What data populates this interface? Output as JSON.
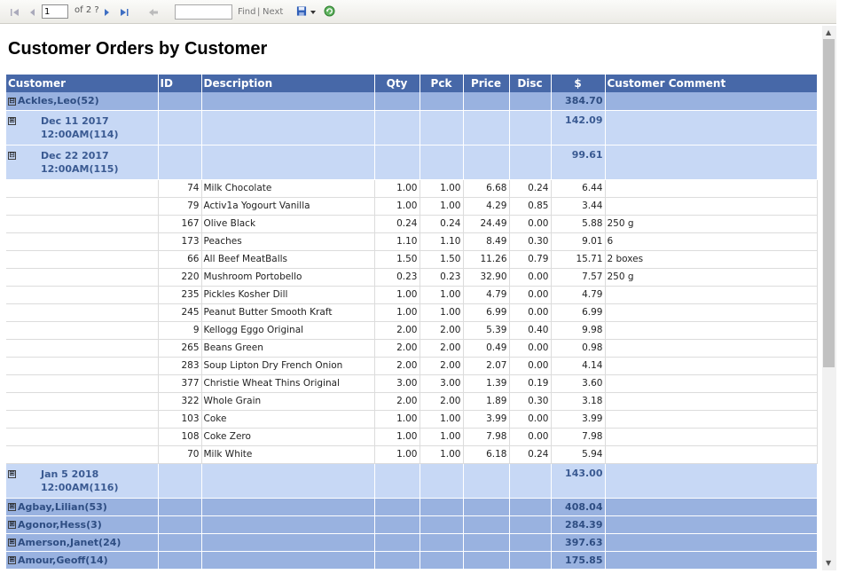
{
  "toolbar": {
    "page_value": "1",
    "page_of": "of 2 ?",
    "find_label": "Find",
    "separator": "|",
    "next_label": "Next"
  },
  "report": {
    "title": "Customer Orders by Customer",
    "columns": [
      "Customer",
      "ID",
      "Description",
      "Qty",
      "Pck",
      "Price",
      "Disc",
      "$",
      "Customer Comment"
    ],
    "customer_main": {
      "toggle": "⊟",
      "name": "Ackles,Leo(52)",
      "total": "384.70"
    },
    "dates": [
      {
        "toggle": "⊞",
        "line1": "Dec 11 2017",
        "line2": "12:00AM(114)",
        "total": "142.09"
      },
      {
        "toggle": "⊟",
        "line1": "Dec 22 2017",
        "line2": "12:00AM(115)",
        "total": "99.61"
      }
    ],
    "items": [
      {
        "id": "74",
        "desc": "Milk Chocolate",
        "qty": "1.00",
        "pck": "1.00",
        "price": "6.68",
        "disc": "0.24",
        "amt": "6.44",
        "comment": ""
      },
      {
        "id": "79",
        "desc": "Activ1a Yogourt Vanilla",
        "qty": "1.00",
        "pck": "1.00",
        "price": "4.29",
        "disc": "0.85",
        "amt": "3.44",
        "comment": ""
      },
      {
        "id": "167",
        "desc": "Olive Black",
        "qty": "0.24",
        "pck": "0.24",
        "price": "24.49",
        "disc": "0.00",
        "amt": "5.88",
        "comment": "250 g"
      },
      {
        "id": "173",
        "desc": "Peaches",
        "qty": "1.10",
        "pck": "1.10",
        "price": "8.49",
        "disc": "0.30",
        "amt": "9.01",
        "comment": "6"
      },
      {
        "id": "66",
        "desc": "All Beef MeatBalls",
        "qty": "1.50",
        "pck": "1.50",
        "price": "11.26",
        "disc": "0.79",
        "amt": "15.71",
        "comment": "2 boxes"
      },
      {
        "id": "220",
        "desc": "Mushroom Portobello",
        "qty": "0.23",
        "pck": "0.23",
        "price": "32.90",
        "disc": "0.00",
        "amt": "7.57",
        "comment": "250 g"
      },
      {
        "id": "235",
        "desc": "Pickles Kosher Dill",
        "qty": "1.00",
        "pck": "1.00",
        "price": "4.79",
        "disc": "0.00",
        "amt": "4.79",
        "comment": ""
      },
      {
        "id": "245",
        "desc": "Peanut Butter Smooth Kraft",
        "qty": "1.00",
        "pck": "1.00",
        "price": "6.99",
        "disc": "0.00",
        "amt": "6.99",
        "comment": ""
      },
      {
        "id": "9",
        "desc": "Kellogg Eggo Original",
        "qty": "2.00",
        "pck": "2.00",
        "price": "5.39",
        "disc": "0.40",
        "amt": "9.98",
        "comment": ""
      },
      {
        "id": "265",
        "desc": "Beans Green",
        "qty": "2.00",
        "pck": "2.00",
        "price": "0.49",
        "disc": "0.00",
        "amt": "0.98",
        "comment": ""
      },
      {
        "id": "283",
        "desc": "Soup Lipton Dry French Onion",
        "qty": "2.00",
        "pck": "2.00",
        "price": "2.07",
        "disc": "0.00",
        "amt": "4.14",
        "comment": ""
      },
      {
        "id": "377",
        "desc": "Christie Wheat Thins Original",
        "qty": "3.00",
        "pck": "3.00",
        "price": "1.39",
        "disc": "0.19",
        "amt": "3.60",
        "comment": ""
      },
      {
        "id": "322",
        "desc": "Whole Grain",
        "qty": "2.00",
        "pck": "2.00",
        "price": "1.89",
        "disc": "0.30",
        "amt": "3.18",
        "comment": ""
      },
      {
        "id": "103",
        "desc": "Coke",
        "qty": "1.00",
        "pck": "1.00",
        "price": "3.99",
        "disc": "0.00",
        "amt": "3.99",
        "comment": ""
      },
      {
        "id": "108",
        "desc": "Coke Zero",
        "qty": "1.00",
        "pck": "1.00",
        "price": "7.98",
        "disc": "0.00",
        "amt": "7.98",
        "comment": ""
      },
      {
        "id": "70",
        "desc": "Milk White",
        "qty": "1.00",
        "pck": "1.00",
        "price": "6.18",
        "disc": "0.24",
        "amt": "5.94",
        "comment": ""
      }
    ],
    "date_last": {
      "toggle": "⊞",
      "line1": "Jan  5 2018",
      "line2": "12:00AM(116)",
      "total": "143.00"
    },
    "other_customers": [
      {
        "toggle": "⊞",
        "name": "Agbay,Lilian(53)",
        "total": "408.04"
      },
      {
        "toggle": "⊞",
        "name": "Agonor,Hess(3)",
        "total": "284.39"
      },
      {
        "toggle": "⊞",
        "name": "Amerson,Janet(24)",
        "total": "397.63"
      },
      {
        "toggle": "⊞",
        "name": "Amour,Geoff(14)",
        "total": "175.85"
      }
    ]
  },
  "colors": {
    "header_bg": "#4768a8",
    "customer_row_bg": "#99b2e0",
    "date_row_bg": "#c7d8f5",
    "group_text": "#2e4d82"
  },
  "icons": [
    "first-page-icon",
    "previous-page-icon",
    "next-page-icon",
    "last-page-icon",
    "back-icon",
    "export-save-icon",
    "dropdown-arrow-icon",
    "refresh-icon"
  ]
}
